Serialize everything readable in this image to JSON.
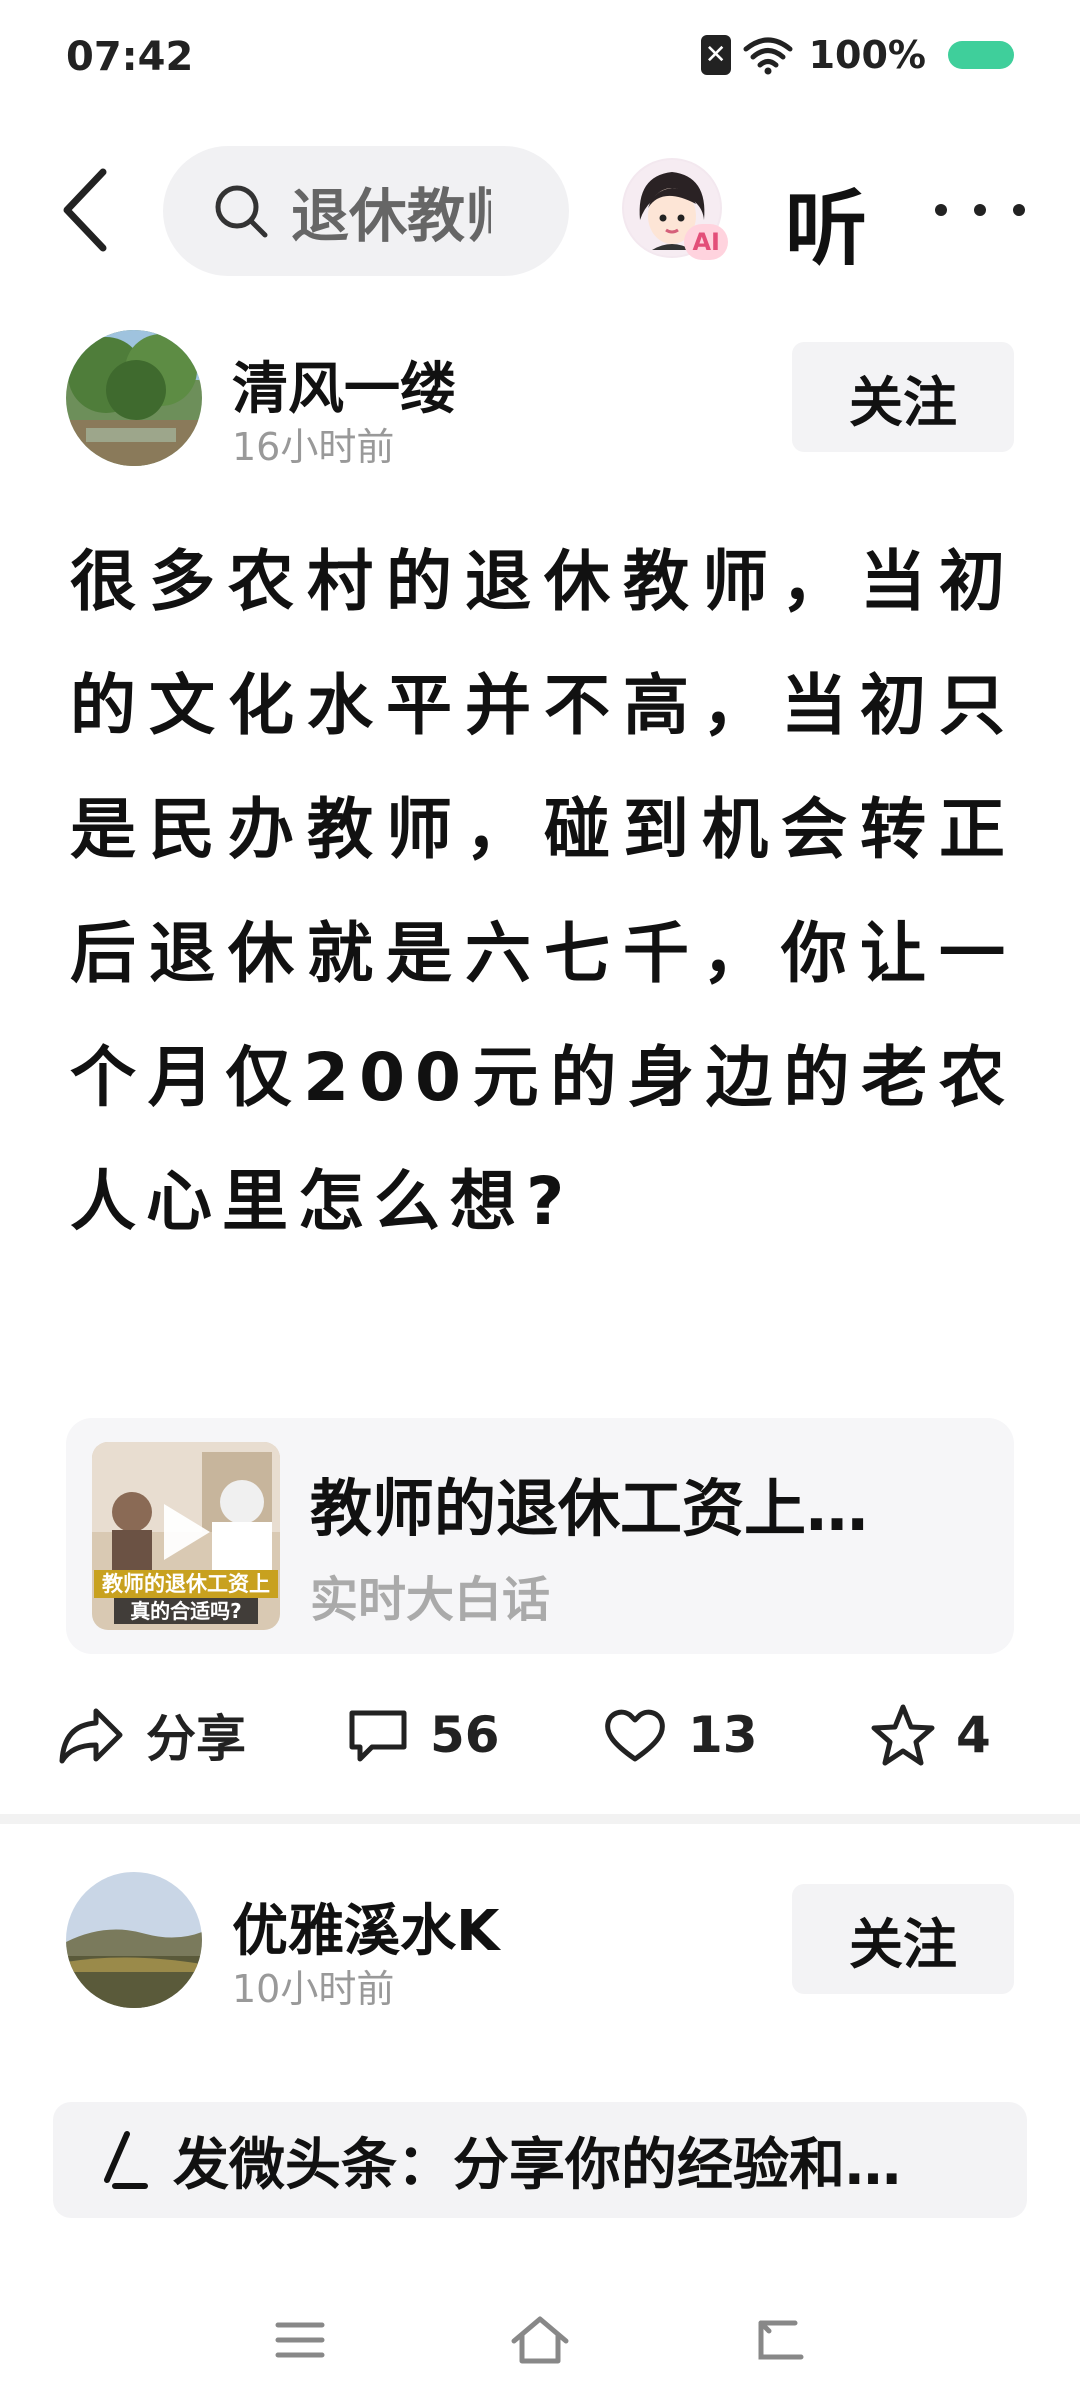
{
  "status": {
    "time": "07:42",
    "battery": "100%"
  },
  "nav": {
    "search_text": "退休教师",
    "listen_label": "听",
    "ai_badge": "AI"
  },
  "posts": [
    {
      "author": "清风一缕",
      "time": "16小时前",
      "follow": "关注",
      "text": "很多农村的退休教师，当初的文化水平并不高，当初只是民办教师，碰到机会转正后退休就是六七千，你让一个月仅200元的身边的老农人心里怎么想?",
      "card": {
        "title": "教师的退休工资上…",
        "source": "实时大白话",
        "thumb_overlay_line1": "教师的退休工资上",
        "thumb_overlay_line2": "真的合适吗?"
      },
      "actions": {
        "share": "分享",
        "comments": "56",
        "likes": "13",
        "favorites": "4"
      }
    },
    {
      "author": "优雅溪水K",
      "time": "10小时前",
      "follow": "关注"
    }
  ],
  "composer": {
    "placeholder": "发微头条：分享你的经验和…"
  },
  "colors": {
    "accent_battery": "#3fcf9b",
    "ai_badge": "#e34e79"
  }
}
